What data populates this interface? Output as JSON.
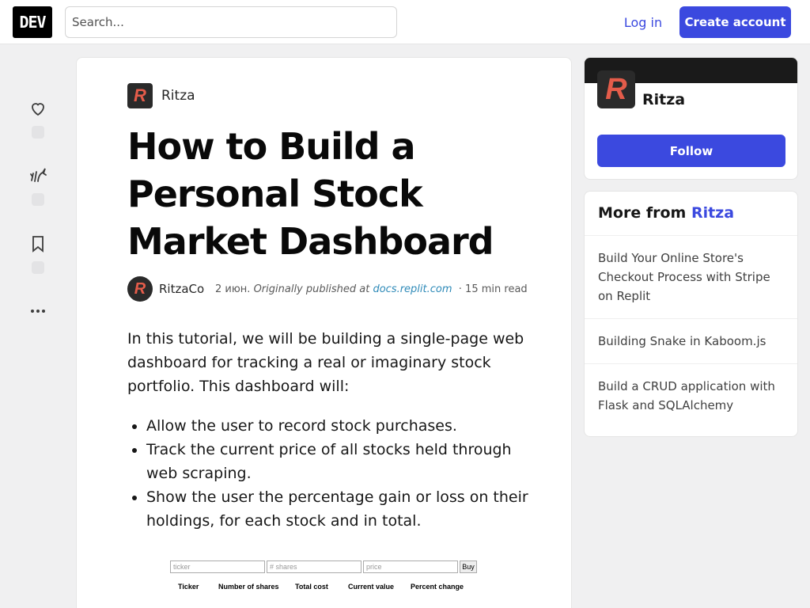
{
  "header": {
    "logo": "DEV",
    "search_placeholder": "Search...",
    "login_label": "Log in",
    "create_label": "Create account"
  },
  "reactions": {
    "heart_icon": "heart-icon",
    "unicorn_icon": "unicorn-icon",
    "bookmark_icon": "bookmark-icon",
    "more_icon": "more-icon"
  },
  "article": {
    "org_initial": "R",
    "org_name": "Ritza",
    "title": "How to Build a Personal Stock Market Dashboard",
    "author_initial": "R",
    "author_name": "RitzaCo",
    "date": "2 июн.",
    "published_prefix": "Originally published at",
    "published_link": "docs.replit.com",
    "read_time": "· 15 min read",
    "intro": "In this tutorial, we will be building a single-page web dashboard for tracking a real or imaginary stock portfolio. This dashboard will:",
    "bullets": [
      "Allow the user to record stock purchases.",
      "Track the current price of all stocks held through web scraping.",
      "Show the user the percentage gain or loss on their holdings, for each stock and in total."
    ],
    "embed": {
      "ticker_placeholder": "ticker",
      "shares_placeholder": "# shares",
      "price_placeholder": "price",
      "buy_label": "Buy",
      "columns": [
        "Ticker",
        "Number of shares",
        "Total cost",
        "Current value",
        "Percent change"
      ]
    }
  },
  "sidebar": {
    "org_initial": "R",
    "org_name": "Ritza",
    "follow_label": "Follow",
    "more_from_prefix": "More from",
    "more_from_brand": "Ritza",
    "more_items": [
      "Build Your Online Store's Checkout Process with Stripe on Replit",
      "Building Snake in Kaboom.js",
      "Build a CRUD application with Flask and SQLAlchemy"
    ]
  },
  "colors": {
    "accent": "#3b49df",
    "link": "#2e8ab8",
    "background": "#f0f0f1"
  }
}
